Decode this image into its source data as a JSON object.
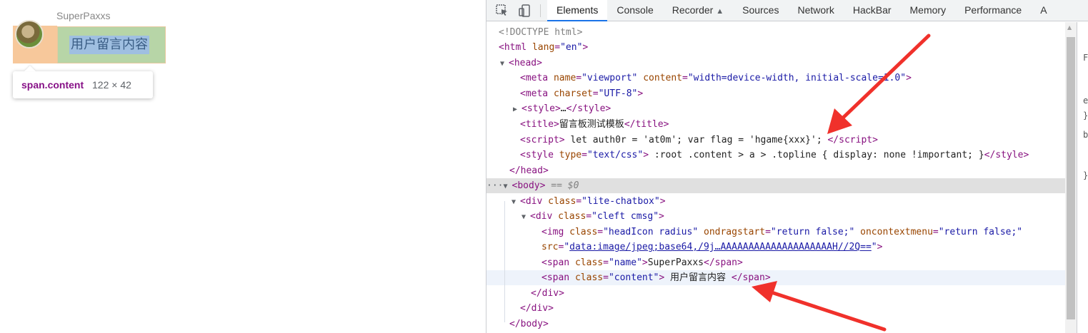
{
  "page": {
    "name": "SuperPaxxs",
    "content": "用户留言内容",
    "tooltip": {
      "selector": "span.content",
      "size": "122 × 42"
    }
  },
  "devtools": {
    "tabs": [
      "Elements",
      "Console",
      "Recorder",
      "Sources",
      "Network",
      "HackBar",
      "Memory",
      "Performance",
      "A"
    ],
    "active_tab": "Elements",
    "dom": [
      {
        "parts": [
          [
            "c",
            "<!DOCTYPE html>"
          ]
        ]
      },
      {
        "parts": [
          [
            "p",
            "<"
          ],
          [
            "t",
            "html"
          ],
          [
            "a",
            " lang"
          ],
          [
            "p",
            "="
          ],
          [
            "v",
            "\"en\""
          ],
          [
            "p",
            ">"
          ]
        ]
      },
      {
        "parts": [
          [
            "tri",
            "▼"
          ],
          [
            "p",
            "<"
          ],
          [
            "t",
            "head"
          ],
          [
            "p",
            ">"
          ]
        ]
      },
      {
        "parts": [
          [
            "p",
            "<"
          ],
          [
            "t",
            "meta"
          ],
          [
            "a",
            " name"
          ],
          [
            "p",
            "="
          ],
          [
            "v",
            "\"viewport\""
          ],
          [
            "a",
            " content"
          ],
          [
            "p",
            "="
          ],
          [
            "v",
            "\"width=device-width, initial-scale=1.0\""
          ],
          [
            "p",
            ">"
          ]
        ]
      },
      {
        "parts": [
          [
            "p",
            "<"
          ],
          [
            "t",
            "meta"
          ],
          [
            "a",
            " charset"
          ],
          [
            "p",
            "="
          ],
          [
            "v",
            "\"UTF-8\""
          ],
          [
            "p",
            ">"
          ]
        ]
      },
      {
        "parts": [
          [
            "tri",
            "▶"
          ],
          [
            "p",
            "<"
          ],
          [
            "t",
            "style"
          ],
          [
            "p",
            ">"
          ],
          [
            "tx",
            "…"
          ],
          [
            "p",
            "</"
          ],
          [
            "t",
            "style"
          ],
          [
            "p",
            ">"
          ]
        ]
      },
      {
        "parts": [
          [
            "p",
            "<"
          ],
          [
            "t",
            "title"
          ],
          [
            "p",
            ">"
          ],
          [
            "tx",
            "留言板测试模板"
          ],
          [
            "p",
            "</"
          ],
          [
            "t",
            "title"
          ],
          [
            "p",
            ">"
          ]
        ]
      },
      {
        "parts": [
          [
            "p",
            "<"
          ],
          [
            "t",
            "script"
          ],
          [
            "p",
            ">"
          ],
          [
            "tx",
            " let auth0r = 'at0m'; var flag = 'hgame{xxx}'; "
          ],
          [
            "p",
            "</"
          ],
          [
            "t",
            "script"
          ],
          [
            "p",
            ">"
          ]
        ]
      },
      {
        "parts": [
          [
            "p",
            "<"
          ],
          [
            "t",
            "style"
          ],
          [
            "a",
            " type"
          ],
          [
            "p",
            "="
          ],
          [
            "v",
            "\"text/css\""
          ],
          [
            "p",
            ">"
          ],
          [
            "tx",
            " :root .content > a > .topline { display: none !important; }"
          ],
          [
            "p",
            "</"
          ],
          [
            "t",
            "style"
          ],
          [
            "p",
            ">"
          ]
        ]
      },
      {
        "parts": [
          [
            "p",
            "</"
          ],
          [
            "t",
            "head"
          ],
          [
            "p",
            ">"
          ]
        ]
      },
      {
        "parts": [
          [
            "dots",
            "···"
          ],
          [
            "tri",
            "▼"
          ],
          [
            "p",
            "<"
          ],
          [
            "t",
            "body"
          ],
          [
            "p",
            ">"
          ],
          [
            "eq",
            " == $0"
          ]
        ]
      },
      {
        "parts": [
          [
            "tri",
            "▼"
          ],
          [
            "p",
            "<"
          ],
          [
            "t",
            "div"
          ],
          [
            "a",
            " class"
          ],
          [
            "p",
            "="
          ],
          [
            "v",
            "\"lite-chatbox\""
          ],
          [
            "p",
            ">"
          ]
        ]
      },
      {
        "parts": [
          [
            "tri",
            "▼"
          ],
          [
            "p",
            "<"
          ],
          [
            "t",
            "div"
          ],
          [
            "a",
            " class"
          ],
          [
            "p",
            "="
          ],
          [
            "v",
            "\"cleft cmsg\""
          ],
          [
            "p",
            ">"
          ]
        ]
      },
      {
        "parts": [
          [
            "p",
            "<"
          ],
          [
            "t",
            "img"
          ],
          [
            "a",
            " class"
          ],
          [
            "p",
            "="
          ],
          [
            "v",
            "\"headIcon radius\""
          ],
          [
            "a",
            " ondragstart"
          ],
          [
            "p",
            "="
          ],
          [
            "v",
            "\"return false;\""
          ],
          [
            "a",
            " oncontextmenu"
          ],
          [
            "p",
            "="
          ],
          [
            "v",
            "\"return false;\""
          ]
        ]
      },
      {
        "parts": [
          [
            "a",
            "src"
          ],
          [
            "p",
            "="
          ],
          [
            "v",
            "\""
          ],
          [
            "lnk",
            "data:image/jpeg;base64,/9j…AAAAAAAAAAAAAAAAAAAAH//2Q=="
          ],
          [
            "v",
            "\""
          ],
          [
            "p",
            ">"
          ]
        ]
      },
      {
        "parts": [
          [
            "p",
            "<"
          ],
          [
            "t",
            "span"
          ],
          [
            "a",
            " class"
          ],
          [
            "p",
            "="
          ],
          [
            "v",
            "\"name\""
          ],
          [
            "p",
            ">"
          ],
          [
            "tx",
            "SuperPaxxs"
          ],
          [
            "p",
            "</"
          ],
          [
            "t",
            "span"
          ],
          [
            "p",
            ">"
          ]
        ]
      },
      {
        "parts": [
          [
            "p",
            "<"
          ],
          [
            "t",
            "span"
          ],
          [
            "a",
            " class"
          ],
          [
            "p",
            "="
          ],
          [
            "v",
            "\"content\""
          ],
          [
            "p",
            ">"
          ],
          [
            "tx",
            " 用户留言内容 "
          ],
          [
            "p",
            "</"
          ],
          [
            "t",
            "span"
          ],
          [
            "p",
            ">"
          ]
        ]
      },
      {
        "parts": [
          [
            "p",
            "</"
          ],
          [
            "t",
            "div"
          ],
          [
            "p",
            ">"
          ]
        ]
      },
      {
        "parts": [
          [
            "p",
            "</"
          ],
          [
            "t",
            "div"
          ],
          [
            "p",
            ">"
          ]
        ]
      },
      {
        "parts": [
          [
            "p",
            "</"
          ],
          [
            "t",
            "body"
          ],
          [
            "p",
            ">"
          ]
        ]
      }
    ],
    "side_glyphs": [
      "F",
      "e",
      "}",
      "b",
      "}"
    ],
    "accent_color": "#1a73e8",
    "arrow_color": "#f0312b"
  }
}
